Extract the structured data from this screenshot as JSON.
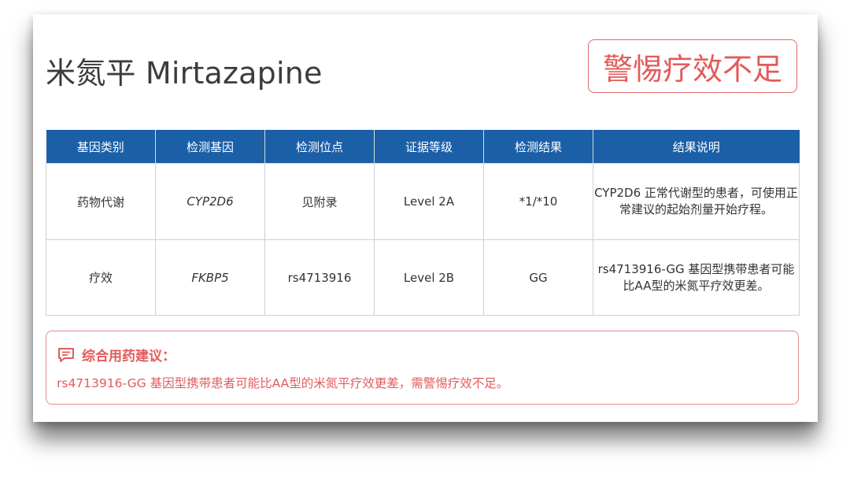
{
  "drug": {
    "title": "米氮平 Mirtazapine",
    "alert": "警惕疗效不足"
  },
  "table": {
    "headers": [
      "基因类别",
      "检测基因",
      "检测位点",
      "证据等级",
      "检测结果",
      "结果说明"
    ],
    "rows": [
      {
        "category": "药物代谢",
        "gene": "CYP2D6",
        "site": "见附录",
        "evidence": "Level 2A",
        "result": "*1/*10",
        "description": "CYP2D6 正常代谢型的患者，可使用正常建议的起始剂量开始疗程。"
      },
      {
        "category": "疗效",
        "gene": "FKBP5",
        "site": "rs4713916",
        "evidence": "Level 2B",
        "result": "GG",
        "description": "rs4713916-GG 基因型携带患者可能比AA型的米氮平疗效更差。"
      }
    ]
  },
  "advice": {
    "icon": "comment-icon",
    "heading": "综合用药建议：",
    "text": "rs4713916-GG 基因型携带患者可能比AA型的米氮平疗效更差，需警惕疗效不足。"
  },
  "colors": {
    "header_blue": "#1b5fa7",
    "alert_red": "#e35b5b",
    "border_red": "#e58a8a"
  }
}
